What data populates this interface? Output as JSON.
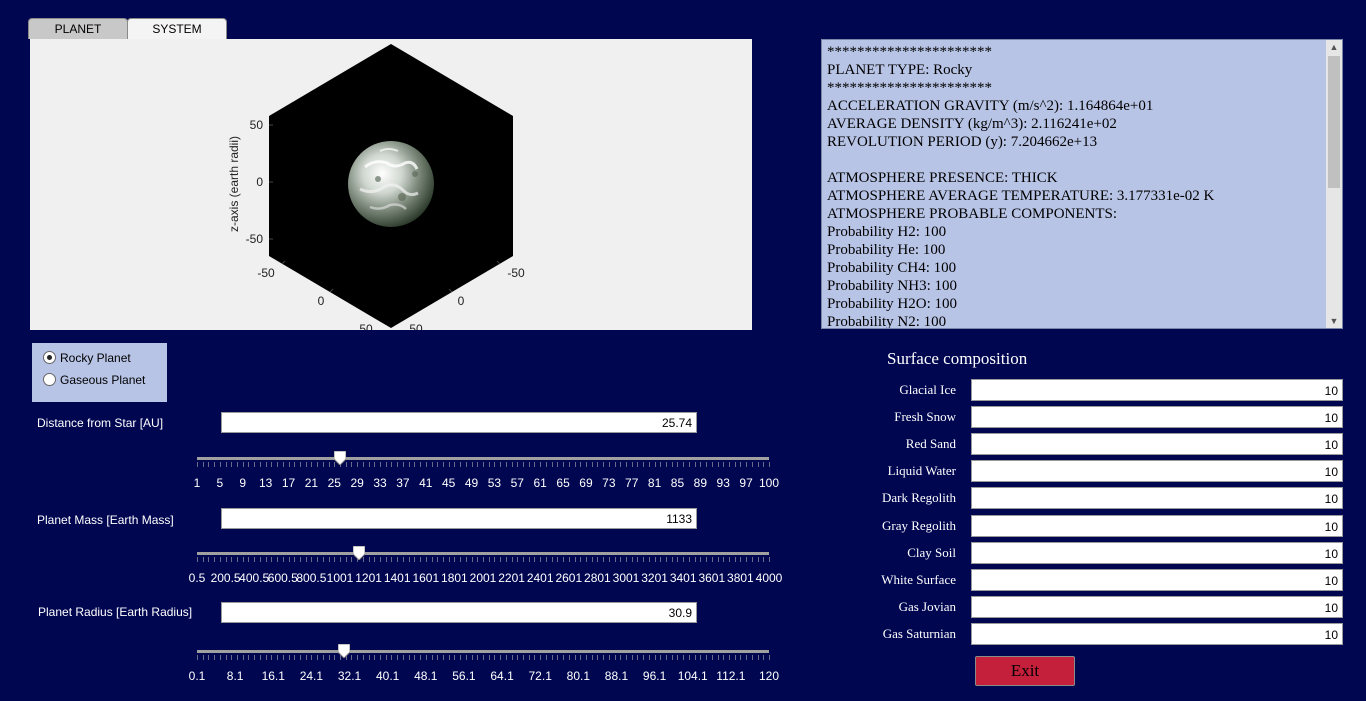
{
  "tabs": [
    {
      "label": "PLANET",
      "active": true
    },
    {
      "label": "SYSTEM",
      "active": false
    }
  ],
  "plot": {
    "zlabel": "z-axis (earth radii)",
    "z_ticks": [
      "50",
      "0",
      "-50"
    ],
    "left_axis_ticks": [
      "-50",
      "0",
      "50"
    ],
    "right_axis_ticks": [
      "-50",
      "0",
      "50"
    ],
    "background_color": "#000000",
    "planet_image": "planet-sphere"
  },
  "console": {
    "lines": [
      "**********************",
      "PLANET TYPE: Rocky",
      "**********************",
      "ACCELERATION GRAVITY (m/s^2): 1.164864e+01",
      "AVERAGE DENSITY (kg/m^3): 2.116241e+02",
      "REVOLUTION PERIOD (y): 7.204662e+13",
      "",
      "ATMOSPHERE PRESENCE: THICK",
      "ATMOSPHERE AVERAGE TEMPERATURE: 3.177331e-02 K",
      "ATMOSPHERE PROBABLE COMPONENTS:",
      "Probability H2: 100",
      "Probability He: 100",
      "Probability CH4: 100",
      "Probability NH3: 100",
      "Probability H2O: 100",
      "Probability N2: 100"
    ],
    "scroll_fraction": 0.0
  },
  "planet_type": {
    "options": [
      {
        "label": "Rocky Planet",
        "selected": true
      },
      {
        "label": "Gaseous Planet",
        "selected": false
      }
    ]
  },
  "distance": {
    "label": "Distance from Star [AU]",
    "value": "25.74",
    "slider_min": 1,
    "slider_max": 100,
    "slider_value": 25.74,
    "tick_labels": [
      "1",
      "5",
      "9",
      "13",
      "17",
      "21",
      "25",
      "29",
      "33",
      "37",
      "41",
      "45",
      "49",
      "53",
      "57",
      "61",
      "65",
      "69",
      "73",
      "77",
      "81",
      "85",
      "89",
      "93",
      "97",
      "100"
    ]
  },
  "mass": {
    "label": "Planet Mass [Earth Mass]",
    "value": "1133",
    "slider_min": 0.5,
    "slider_max": 4000,
    "slider_value": 1133,
    "tick_labels": [
      "0.5",
      "200.5",
      "400.5",
      "600.5",
      "800.5",
      "1001",
      "1201",
      "1401",
      "1601",
      "1801",
      "2001",
      "2201",
      "2401",
      "2601",
      "2801",
      "3001",
      "3201",
      "3401",
      "3601",
      "3801",
      "4000"
    ]
  },
  "radius": {
    "label": "Planet Radius [Earth Radius]",
    "value": "30.9",
    "slider_min": 0.1,
    "slider_max": 120,
    "slider_value": 30.9,
    "tick_labels": [
      "0.1",
      "8.1",
      "16.1",
      "24.1",
      "32.1",
      "40.1",
      "48.1",
      "56.1",
      "64.1",
      "72.1",
      "80.1",
      "88.1",
      "96.1",
      "104.1",
      "112.1",
      "120"
    ]
  },
  "surface": {
    "title": "Surface composition",
    "items": [
      {
        "label": "Glacial Ice",
        "value": "10"
      },
      {
        "label": "Fresh Snow",
        "value": "10"
      },
      {
        "label": "Red Sand",
        "value": "10"
      },
      {
        "label": "Liquid Water",
        "value": "10"
      },
      {
        "label": "Dark Regolith",
        "value": "10"
      },
      {
        "label": "Gray Regolith",
        "value": "10"
      },
      {
        "label": "Clay Soil",
        "value": "10"
      },
      {
        "label": "White Surface",
        "value": "10"
      },
      {
        "label": "Gas Jovian",
        "value": "10"
      },
      {
        "label": "Gas Saturnian",
        "value": "10"
      }
    ]
  },
  "exit_label": "Exit",
  "colors": {
    "background": "#000650",
    "panel": "#b8c4e6",
    "exit_button": "#c4203c"
  }
}
